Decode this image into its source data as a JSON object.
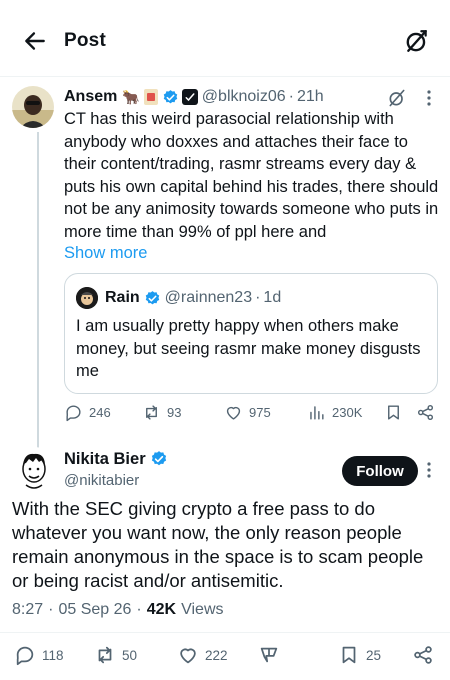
{
  "header": {
    "title": "Post"
  },
  "post1": {
    "author_name": "Ansem",
    "emojis": [
      "🐂"
    ],
    "handle": "@blknoiz06",
    "time": "21h",
    "text": "CT has this weird parasocial relationship with anybody who doxxes and attaches their face to their content/trading, rasmr streams every day & puts his own capital behind his trades, there should not be any animosity towards someone who puts in more time than 99% of ppl here and",
    "show_more": "Show more",
    "quote": {
      "author_name": "Rain",
      "handle": "@rainnen23",
      "time": "1d",
      "text": "I am usually pretty happy when others make money, but seeing rasmr make money disgusts me"
    },
    "stats": {
      "replies": "246",
      "reposts": "93",
      "likes": "975",
      "views": "230K"
    }
  },
  "post2": {
    "author_name": "Nikita Bier",
    "handle": "@nikitabier",
    "follow_label": "Follow",
    "text": "With the SEC giving crypto a free pass to do whatever you want now, the only reason people remain anonymous in the space is to scam people or being racist and/or antisemitic.",
    "time": "8:27",
    "date": "05 Sep 26",
    "views_count": "42K",
    "views_label": "Views",
    "stats": {
      "replies": "118",
      "reposts": "50",
      "likes": "222",
      "bookmarks": "25"
    }
  },
  "colors": {
    "accent": "#1d9bf0",
    "text": "#0f1419",
    "muted": "#536471",
    "border": "#cfd9de"
  },
  "icons": [
    "back-arrow-icon",
    "grok-icon",
    "verified-icon",
    "more-icon",
    "reply-icon",
    "repost-icon",
    "like-icon",
    "views-icon",
    "bookmark-icon",
    "share-icon",
    "tip-icon"
  ]
}
